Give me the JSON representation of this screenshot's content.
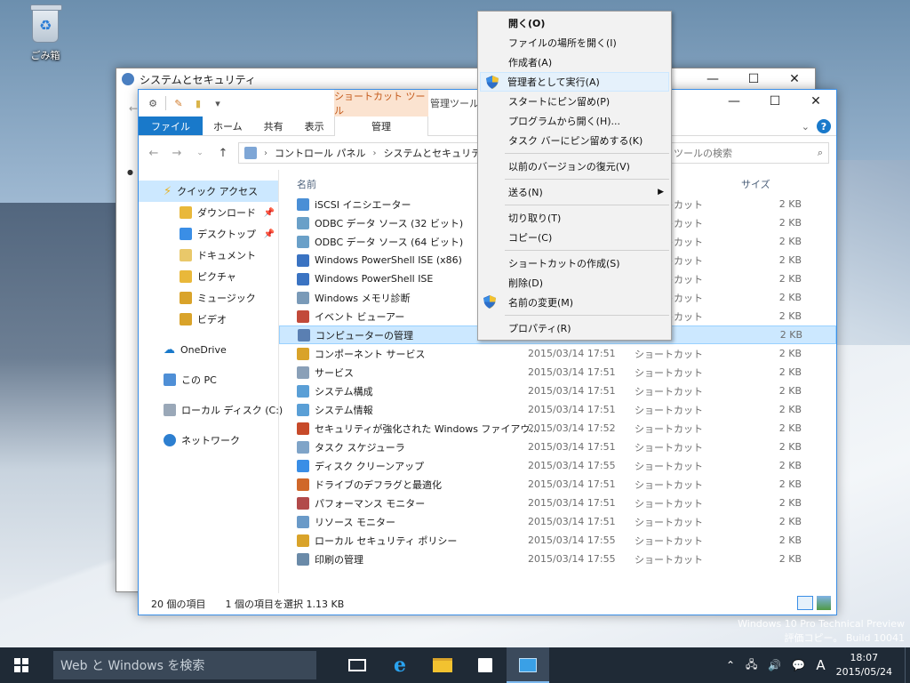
{
  "desktop": {
    "recycle_bin_label": "ごみ箱"
  },
  "back_window": {
    "title": "システムとセキュリティ"
  },
  "window": {
    "context_tab_header": "ショートカット ツール",
    "context_tab_header2": "管理ツール",
    "tabs": {
      "file": "ファイル",
      "home": "ホーム",
      "share": "共有",
      "view": "表示",
      "manage": "管理"
    },
    "breadcrumb": [
      "コントロール パネル",
      "システムとセキュリティ",
      "管"
    ],
    "search_placeholder": "ツールの検索",
    "columns": {
      "name": "名前",
      "size": "サイズ"
    },
    "nav": {
      "quick_access": "クイック アクセス",
      "downloads": "ダウンロード",
      "desktop": "デスクトップ",
      "documents": "ドキュメント",
      "pictures": "ピクチャ",
      "music": "ミュージック",
      "videos": "ビデオ",
      "onedrive": "OneDrive",
      "this_pc": "この PC",
      "local_disk": "ローカル ディスク (C:)",
      "network": "ネットワーク"
    },
    "files": [
      {
        "name": "iSCSI イニシエーター",
        "date": "",
        "type": "ショートカット",
        "size": "2 KB"
      },
      {
        "name": "ODBC データ ソース (32 ビット)",
        "date": "",
        "type": "ショートカット",
        "size": "2 KB"
      },
      {
        "name": "ODBC データ ソース (64 ビット)",
        "date": "",
        "type": "ショートカット",
        "size": "2 KB"
      },
      {
        "name": "Windows PowerShell ISE (x86)",
        "date": "",
        "type": "ショートカット",
        "size": "2 KB"
      },
      {
        "name": "Windows PowerShell ISE",
        "date": "",
        "type": "ショートカット",
        "size": "2 KB"
      },
      {
        "name": "Windows メモリ診断",
        "date": "",
        "type": "ショートカット",
        "size": "2 KB"
      },
      {
        "name": "イベント ビューアー",
        "date": "",
        "type": "ショートカット",
        "size": "2 KB"
      },
      {
        "name": "コンピューターの管理",
        "date": "2015/03/14 17:51",
        "type": "",
        "size": "2 KB"
      },
      {
        "name": "コンポーネント サービス",
        "date": "2015/03/14 17:51",
        "type": "ショートカット",
        "size": "2 KB"
      },
      {
        "name": "サービス",
        "date": "2015/03/14 17:51",
        "type": "ショートカット",
        "size": "2 KB"
      },
      {
        "name": "システム構成",
        "date": "2015/03/14 17:51",
        "type": "ショートカット",
        "size": "2 KB"
      },
      {
        "name": "システム情報",
        "date": "2015/03/14 17:51",
        "type": "ショートカット",
        "size": "2 KB"
      },
      {
        "name": "セキュリティが強化された Windows ファイアウ...",
        "date": "2015/03/14 17:52",
        "type": "ショートカット",
        "size": "2 KB"
      },
      {
        "name": "タスク スケジューラ",
        "date": "2015/03/14 17:51",
        "type": "ショートカット",
        "size": "2 KB"
      },
      {
        "name": "ディスク クリーンアップ",
        "date": "2015/03/14 17:55",
        "type": "ショートカット",
        "size": "2 KB"
      },
      {
        "name": "ドライブのデフラグと最適化",
        "date": "2015/03/14 17:51",
        "type": "ショートカット",
        "size": "2 KB"
      },
      {
        "name": "パフォーマンス モニター",
        "date": "2015/03/14 17:51",
        "type": "ショートカット",
        "size": "2 KB"
      },
      {
        "name": "リソース モニター",
        "date": "2015/03/14 17:51",
        "type": "ショートカット",
        "size": "2 KB"
      },
      {
        "name": "ローカル セキュリティ ポリシー",
        "date": "2015/03/14 17:55",
        "type": "ショートカット",
        "size": "2 KB"
      },
      {
        "name": "印刷の管理",
        "date": "2015/03/14 17:55",
        "type": "ショートカット",
        "size": "2 KB"
      }
    ],
    "status": {
      "count": "20 個の項目",
      "selection": "1 個の項目を選択  1.13 KB"
    }
  },
  "context_menu": {
    "items": [
      "開く(O)",
      "ファイルの場所を開く(I)",
      "作成者(A)",
      "管理者として実行(A)",
      "スタートにピン留め(P)",
      "プログラムから開く(H)...",
      "タスク バーにピン留めする(K)",
      "以前のバージョンの復元(V)",
      "送る(N)",
      "切り取り(T)",
      "コピー(C)",
      "ショートカットの作成(S)",
      "削除(D)",
      "名前の変更(M)",
      "プロパティ(R)"
    ]
  },
  "taskbar": {
    "search_placeholder": "Web と Windows を検索",
    "time": "18:07",
    "date": "2015/05/24",
    "ime": "A"
  },
  "watermark": {
    "line1": "Windows 10 Pro Technical Preview",
    "line2": "評価コピー。 Build 10041"
  },
  "colors": {
    "accent": "#1979ca",
    "selection": "#cce8ff",
    "context_tab": "#fbe3d0",
    "taskbar": "#1f2a36"
  }
}
